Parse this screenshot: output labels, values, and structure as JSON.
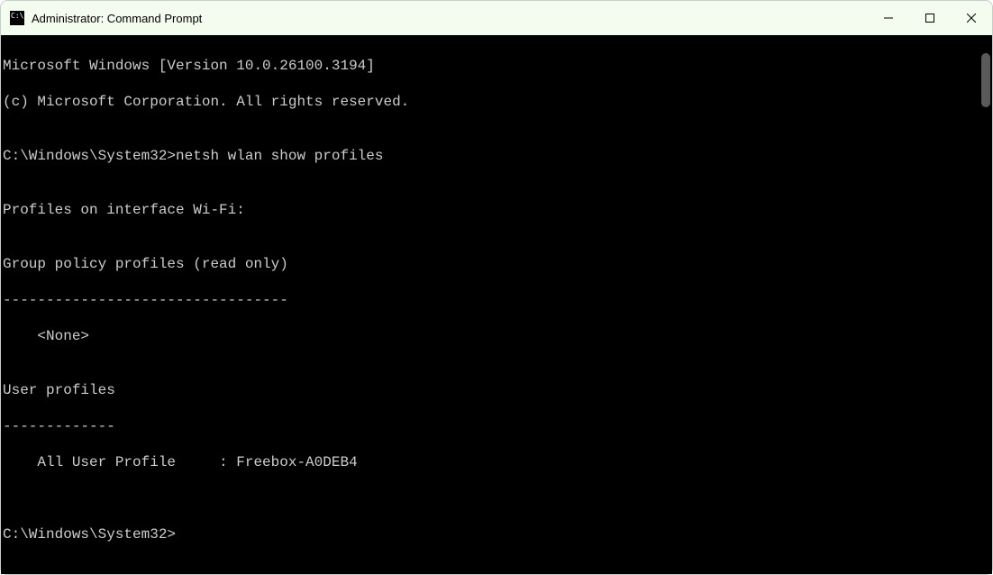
{
  "window": {
    "title": "Administrator: Command Prompt"
  },
  "terminal": {
    "header_line1": "Microsoft Windows [Version 10.0.26100.3194]",
    "header_line2": "(c) Microsoft Corporation. All rights reserved.",
    "blank": "",
    "prompt1_path": "C:\\Windows\\System32>",
    "prompt1_command": "netsh wlan show profiles",
    "output_blank1": "",
    "output_interface": "Profiles on interface Wi-Fi:",
    "output_blank2": "",
    "output_group_header": "Group policy profiles (read only)",
    "output_group_divider": "---------------------------------",
    "output_group_none": "    <None>",
    "output_blank3": "",
    "output_user_header": "User profiles",
    "output_user_divider": "-------------",
    "output_user_profile": "    All User Profile     : Freebox-A0DEB4",
    "output_blank4": "",
    "output_blank5": "",
    "prompt2_path": "C:\\Windows\\System32>"
  }
}
